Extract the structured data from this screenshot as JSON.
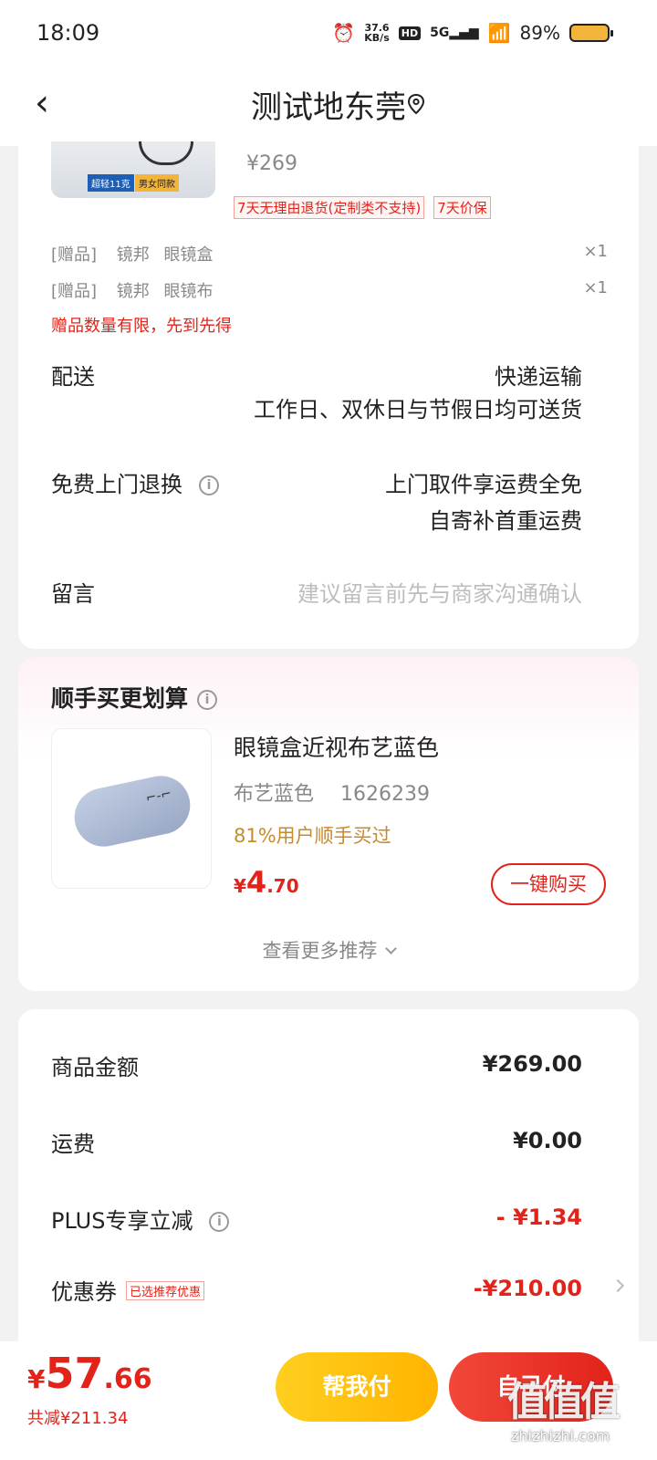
{
  "status": {
    "time": "18:09",
    "net_speed_value": "37.6",
    "net_speed_unit": "KB/s",
    "hd": "HD",
    "signal": "5G",
    "battery": "89%"
  },
  "header": {
    "title": "测试地东莞"
  },
  "product": {
    "img_tag_light": "超轻11克",
    "img_tag_gender": "男女同款",
    "price": "¥269",
    "badge_return": "7天无理由退货(定制类不支持)",
    "badge_price_protect": "7天价保"
  },
  "gifts": [
    {
      "tag": "[赠品]",
      "brand": "镜邦",
      "name": "眼镜盒",
      "qty": "×1"
    },
    {
      "tag": "[赠品]",
      "brand": "镜邦",
      "name": "眼镜布",
      "qty": "×1"
    }
  ],
  "gift_note": "赠品数量有限，先到先得",
  "delivery": {
    "label": "配送",
    "method": "快递运输",
    "detail": "工作日、双休日与节假日均可送货"
  },
  "return": {
    "label": "免费上门退换",
    "line1": "上门取件享运费全免",
    "line2": "自寄补首重运费"
  },
  "message": {
    "label": "留言",
    "placeholder": "建议留言前先与商家沟通确认"
  },
  "recommend": {
    "title": "顺手买更划算",
    "name": "眼镜盒近视布艺蓝色",
    "spec": "布艺蓝色",
    "sku": "1626239",
    "tip": "81%用户顺手买过",
    "price_symbol": "¥",
    "price_int": "4",
    "price_dec": ".70",
    "buy_label": "一键购买",
    "more_label": "查看更多推荐"
  },
  "amounts": {
    "goods_label": "商品金额",
    "goods_value": "¥269.00",
    "freight_label": "运费",
    "freight_value": "¥0.00",
    "plus_label": "PLUS专享立减",
    "plus_value": "- ¥1.34",
    "coupon_label": "优惠券",
    "coupon_tag": "已选推荐优惠",
    "coupon_value": "-¥210.00"
  },
  "bottom": {
    "total_symbol": "¥",
    "total_int": "57",
    "total_dec": ".66",
    "saved": "共减¥211.34",
    "help_pay": "帮我付",
    "pay": "自己付"
  },
  "watermark": {
    "big": "值值值",
    "small": "zhizhizhi.com"
  },
  "colors": {
    "accent_red": "#e2231a",
    "yellow": "#ffc107",
    "tip_orange": "#c98a2b"
  }
}
